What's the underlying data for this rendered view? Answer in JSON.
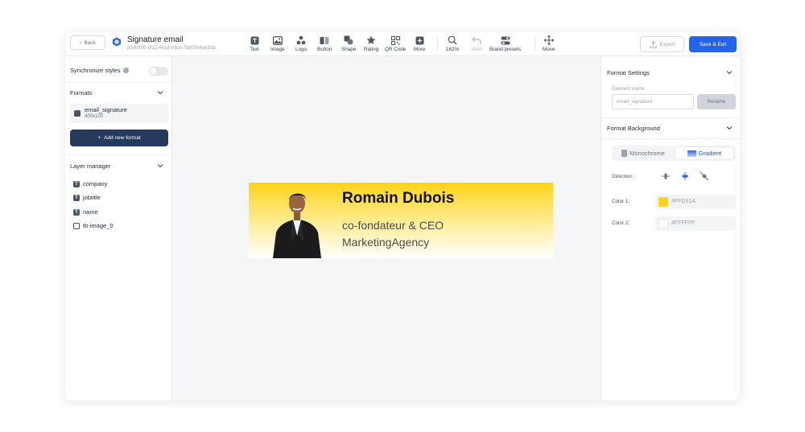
{
  "topbar": {
    "back_label": "Back",
    "title": "Signature email",
    "document_id": "d3dfdf00-5f12-441d-bdcd-7dd0064a63da",
    "tools": [
      {
        "label": "Text",
        "icon": "text-icon"
      },
      {
        "label": "Image",
        "icon": "image-icon"
      },
      {
        "label": "Logo",
        "icon": "logo-icon"
      },
      {
        "label": "Button",
        "icon": "button-icon"
      },
      {
        "label": "Shape",
        "icon": "shape-icon"
      },
      {
        "label": "Rating",
        "icon": "star-icon"
      },
      {
        "label": "QR Code",
        "icon": "qr-code-icon"
      },
      {
        "label": "More",
        "icon": "plus-icon"
      }
    ],
    "zoom": "162%",
    "undo_label": "Undo",
    "brand_presets_label": "Brand presets",
    "move_label": "Move",
    "export_label": "Export",
    "save_label": "Save & Exit",
    "accent_color": "#2563eb"
  },
  "left_panel": {
    "sync_label": "Synchronize styles",
    "sync_enabled": false,
    "formats_title": "Formats",
    "formats": [
      {
        "name": "email_signature",
        "size": "400x100"
      }
    ],
    "add_format_label": "Add new format",
    "layer_manager_title": "Layer manager",
    "layers": [
      {
        "name": "company",
        "type": "text"
      },
      {
        "name": "jobtitle",
        "type": "text"
      },
      {
        "name": "name",
        "type": "text"
      },
      {
        "name": "tb-image_0",
        "type": "image"
      }
    ]
  },
  "canvas": {
    "name": "Romain Dubois",
    "jobtitle": "co-fondateur & CEO",
    "company": "MarketingAgency"
  },
  "right_panel": {
    "format_settings_title": "Format Settings",
    "element_name_label": "Element name",
    "element_name_placeholder": "email_signature",
    "rename_label": "Rename",
    "format_background_title": "Format Background",
    "monochrome_label": "Monochrome",
    "gradient_label": "Gradient",
    "active_mode": "gradient",
    "direction_label": "Direction:",
    "color1_label": "Color 1:",
    "color1_value": "#FFD31A",
    "color2_label": "Color 2:",
    "color2_value": "#FFFFFF"
  }
}
